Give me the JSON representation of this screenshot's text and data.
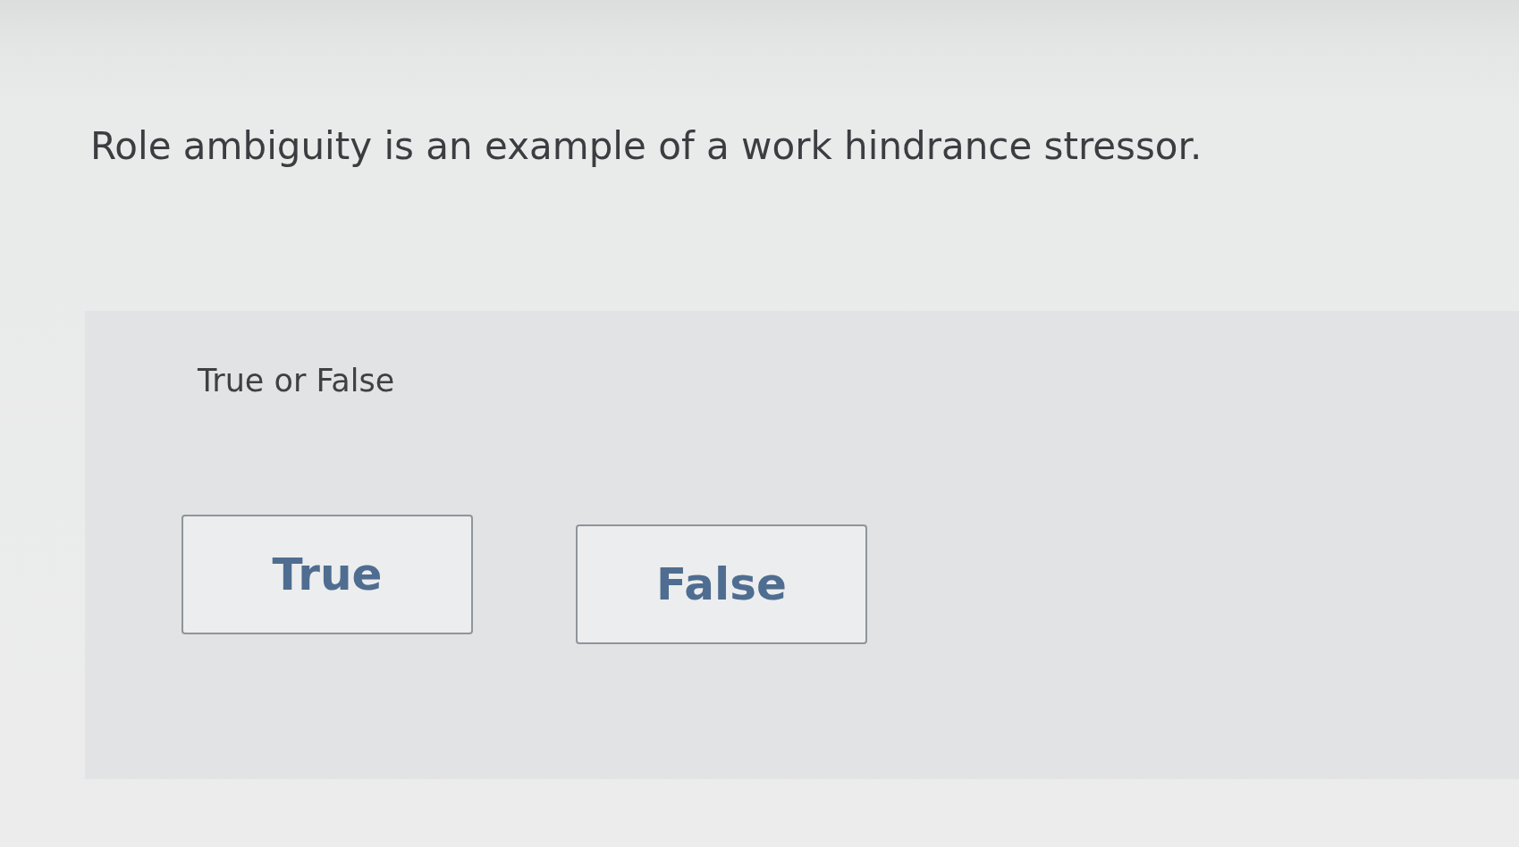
{
  "question": {
    "text": "Role ambiguity is an example of a work hindrance stressor."
  },
  "answer_panel": {
    "prompt": "True or False",
    "options": [
      {
        "label": "True",
        "selected": false
      },
      {
        "label": "False",
        "selected": false
      }
    ]
  }
}
